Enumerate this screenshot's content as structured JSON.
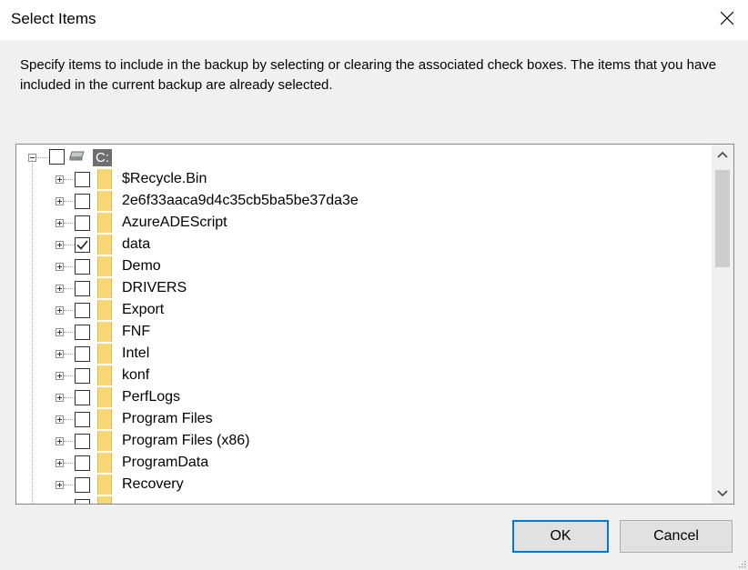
{
  "window": {
    "title": "Select Items"
  },
  "instructions": "Specify items to include in the backup by selecting or clearing the associated check boxes. The items that you have included in the current backup are already selected.",
  "tree": {
    "root": {
      "label": "C:",
      "checked": false,
      "expanded": true
    },
    "items": [
      {
        "label": "$Recycle.Bin",
        "checked": false
      },
      {
        "label": "2e6f33aaca9d4c35cb5ba5be37da3e",
        "checked": false
      },
      {
        "label": "AzureADEScript",
        "checked": false
      },
      {
        "label": "data",
        "checked": true
      },
      {
        "label": "Demo",
        "checked": false
      },
      {
        "label": "DRIVERS",
        "checked": false
      },
      {
        "label": "Export",
        "checked": false
      },
      {
        "label": "FNF",
        "checked": false
      },
      {
        "label": "Intel",
        "checked": false
      },
      {
        "label": "konf",
        "checked": false
      },
      {
        "label": "PerfLogs",
        "checked": false
      },
      {
        "label": "Program Files",
        "checked": false
      },
      {
        "label": "Program Files (x86)",
        "checked": false
      },
      {
        "label": "ProgramData",
        "checked": false
      },
      {
        "label": "Recovery",
        "checked": false
      }
    ]
  },
  "buttons": {
    "ok": "OK",
    "cancel": "Cancel"
  },
  "colors": {
    "accent": "#0078d7",
    "folder": "#f8d775",
    "selection": "#6e6e6e"
  }
}
